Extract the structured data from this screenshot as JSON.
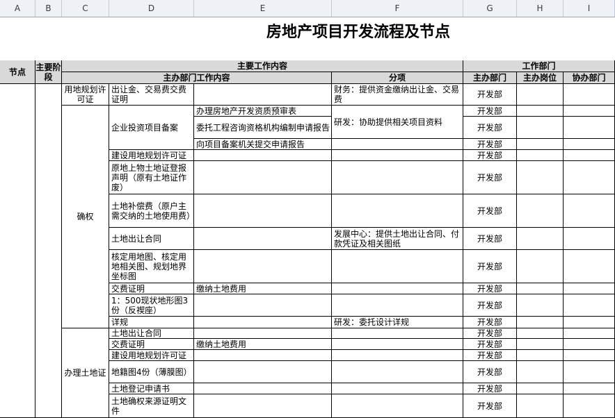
{
  "columns": [
    "A",
    "B",
    "C",
    "D",
    "E",
    "F",
    "G",
    "H",
    "I"
  ],
  "title": "房地产项目开发流程及节点",
  "headers": {
    "node": "节点",
    "main_stage": "主要阶段",
    "main_work": "主要工作内容",
    "lead_dept_work": "主办部门工作内容",
    "sub_item": "分项",
    "work_dept": "工作部门",
    "lead_dept": "主办部门",
    "lead_post": "主办岗位",
    "assist_dept": "协办部门"
  },
  "section_queren": "确权",
  "section_banli": "办理土地证",
  "cells": {
    "c_top": "用地规划许可证",
    "d1": "出让金、交易费交费证明",
    "f1": "财务：提供资金缴纳出让金、交易费",
    "d_group": "企业投资项目备案",
    "e2": "办理房地产开发资质预审表",
    "e3": "委托工程咨询资格机构编制申请报告",
    "f_group": "研发：协助提供相关项目资料",
    "e4": "向项目备案机关提交申请报告",
    "d5": "建设用地规划许可证",
    "d6": "原地上物土地证登报声明（原有土地证作废）",
    "d7": "土地补偿费（原户主需交纳的土地使用费）",
    "d8": "土地出让合同",
    "f8": "发展中心：提供土地出让合同、付款凭证及相关图纸",
    "d9": "核定用地图、核定用地相关图、规划地界坐标图",
    "d10": "交费证明",
    "e10": "缴纳土地费用",
    "d11": "1：500现状地形图3份（反禊座）",
    "d12": "详规",
    "f12": "研发：委托设计详规",
    "d13": "土地出让合同",
    "d14": "交费证明",
    "e14": "缴纳土地费用",
    "d15": "建设用地规划许可证",
    "d16": "地籍图4份（薄膜图）",
    "d17": "土地登记申请书",
    "d18": "土地确权来源证明文件"
  },
  "dept": "开发部"
}
